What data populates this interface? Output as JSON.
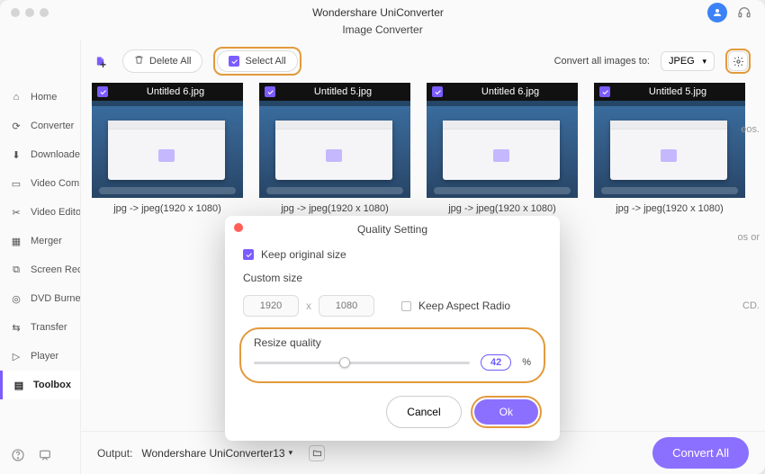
{
  "app": {
    "title": "Wondershare UniConverter",
    "subtitle": "Image Converter"
  },
  "sidebar": {
    "items": [
      {
        "label": "Home",
        "glyph": "⌂"
      },
      {
        "label": "Converter",
        "glyph": "⟳"
      },
      {
        "label": "Downloader",
        "glyph": "⬇"
      },
      {
        "label": "Video Compressor",
        "glyph": "▭"
      },
      {
        "label": "Video Editor",
        "glyph": "✂"
      },
      {
        "label": "Merger",
        "glyph": "▦"
      },
      {
        "label": "Screen Recorder",
        "glyph": "⧉"
      },
      {
        "label": "DVD Burner",
        "glyph": "◎"
      },
      {
        "label": "Transfer",
        "glyph": "⇆"
      },
      {
        "label": "Player",
        "glyph": "▷"
      },
      {
        "label": "Toolbox",
        "glyph": "▤"
      }
    ],
    "active_index": 10
  },
  "toolbar": {
    "delete_all": "Delete All",
    "select_all": "Select All",
    "convert_to_label": "Convert all images to:",
    "format": "JPEG"
  },
  "thumbnails": [
    {
      "name": "Untitled 6.jpg",
      "meta": "jpg -> jpeg(1920 x 1080)"
    },
    {
      "name": "Untitled 5.jpg",
      "meta": "jpg -> jpeg(1920 x 1080)"
    },
    {
      "name": "Untitled 6.jpg",
      "meta": "jpg -> jpeg(1920 x 1080)"
    },
    {
      "name": "Untitled 5.jpg",
      "meta": "jpg -> jpeg(1920 x 1080)"
    }
  ],
  "output": {
    "label": "Output:",
    "path": "Wondershare UniConverter13",
    "convert_all": "Convert All"
  },
  "dialog": {
    "title": "Quality Setting",
    "keep_original": "Keep original size",
    "custom_size_label": "Custom size",
    "width": "1920",
    "height": "1080",
    "aspect_label": "Keep Aspect Radio",
    "resize_label": "Resize quality",
    "quality": "42",
    "unit": "%",
    "cancel": "Cancel",
    "ok": "Ok"
  },
  "truncated": {
    "t1": "eos.",
    "t2": "os or",
    "t3": "CD."
  },
  "colors": {
    "accent": "#8b70ff",
    "highlight": "#e29a3c"
  }
}
